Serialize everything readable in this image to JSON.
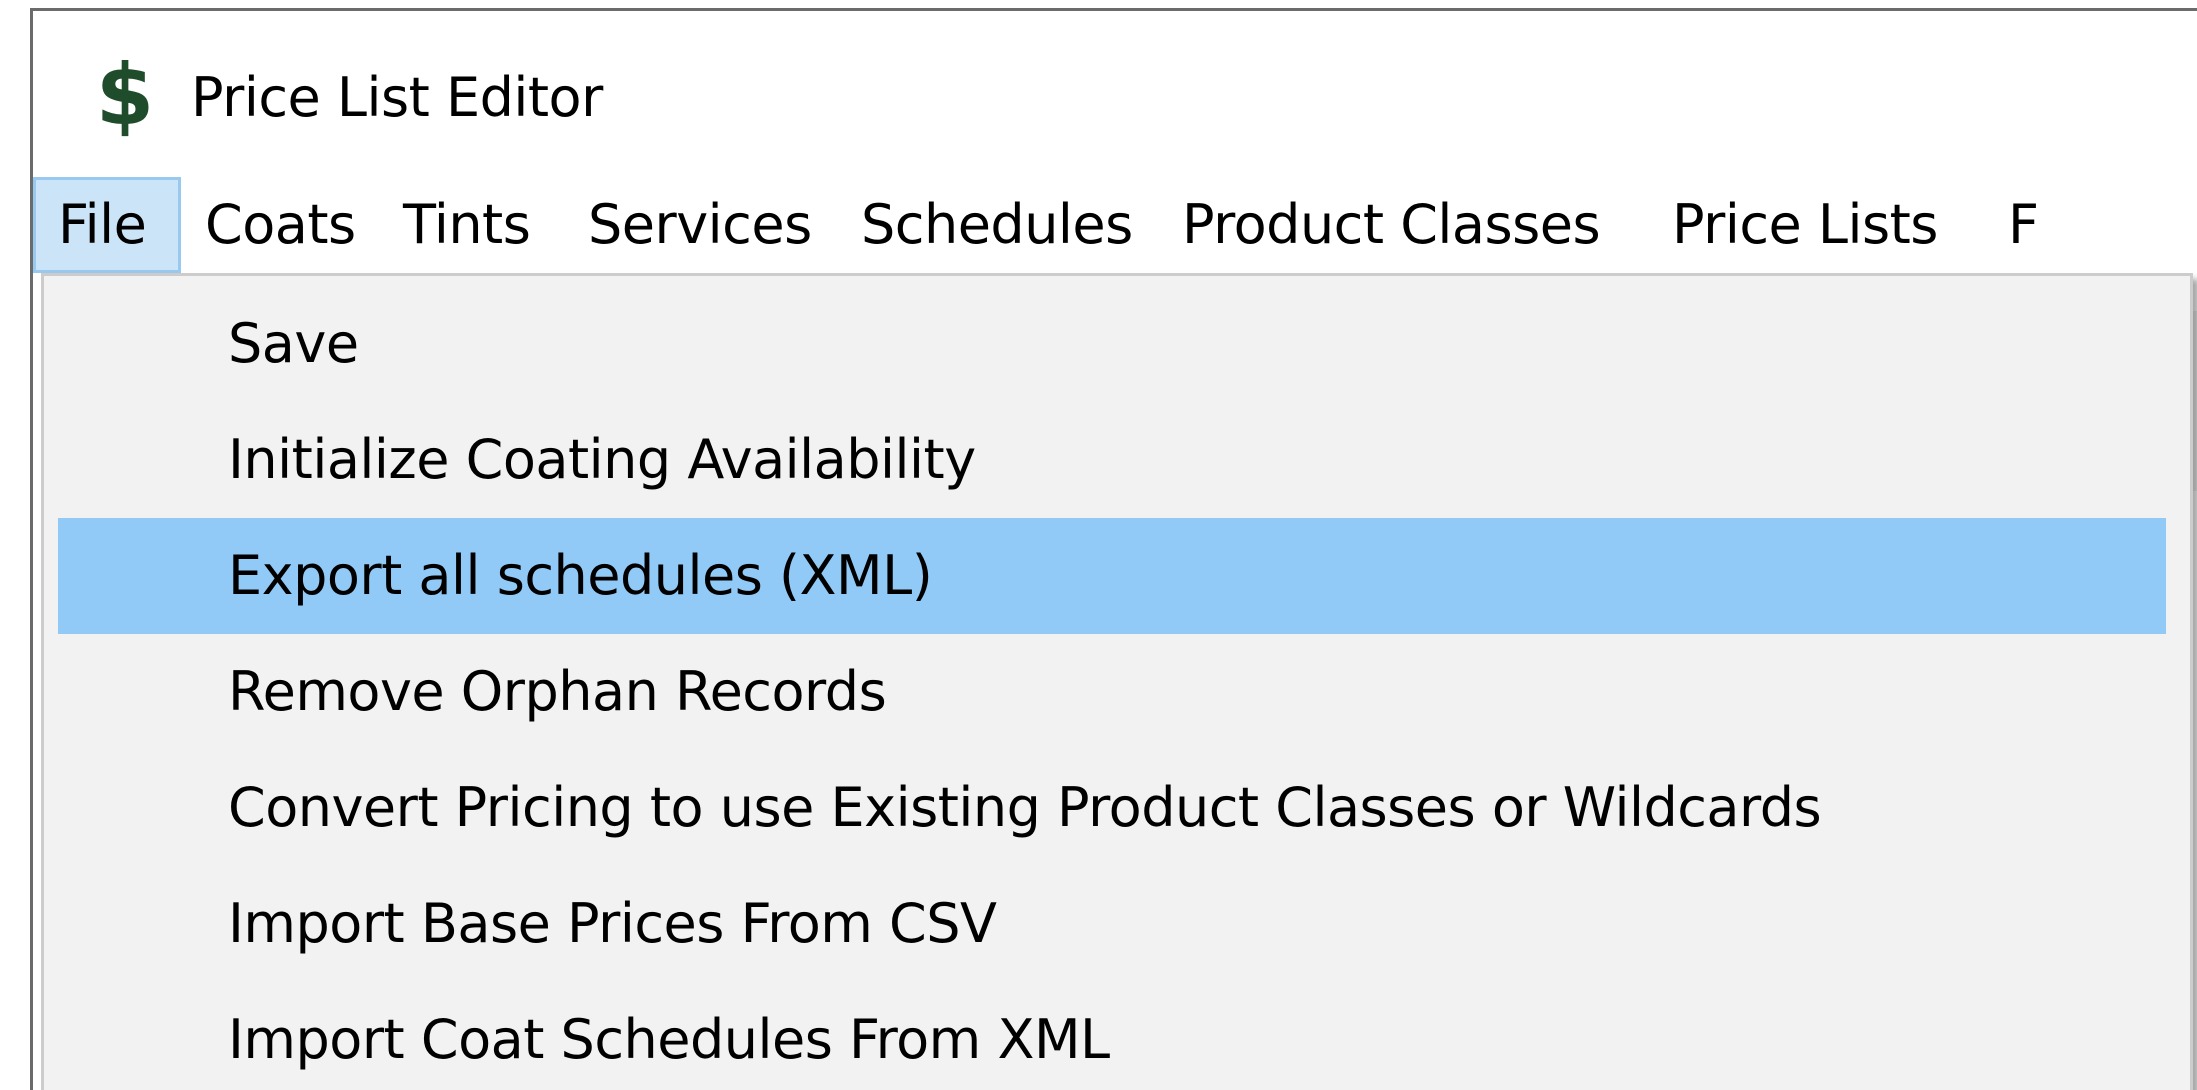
{
  "window": {
    "title": "Price List Editor",
    "icon": "dollar-sign-icon"
  },
  "menubar": {
    "items": [
      {
        "label": "File",
        "active": true
      },
      {
        "label": "Coats"
      },
      {
        "label": "Tints"
      },
      {
        "label": "Services"
      },
      {
        "label": "Schedules"
      },
      {
        "label": "Product Classes"
      },
      {
        "label": "Price Lists"
      },
      {
        "label": "F"
      }
    ]
  },
  "file_menu": {
    "items": [
      {
        "label": "Save"
      },
      {
        "label": "Initialize Coating Availability"
      },
      {
        "label": "Export all schedules (XML)",
        "highlighted": true
      },
      {
        "label": "Remove Orphan Records"
      },
      {
        "label": "Convert Pricing to use Existing Product Classes or Wildcards"
      },
      {
        "label": "Import Base Prices From CSV"
      },
      {
        "label": "Import Coat Schedules From XML"
      }
    ]
  },
  "colors": {
    "menu_active_bg": "#cce4f7",
    "menu_active_border": "#99c9ef",
    "dropdown_bg": "#f2f2f2",
    "dropdown_highlight": "#91c9f7",
    "icon_color": "#1f4d2b"
  }
}
